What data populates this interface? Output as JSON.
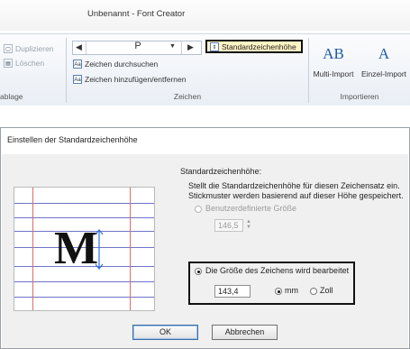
{
  "ribbon": {
    "window_title": "Unbenannt - Font Creator",
    "groups": {
      "clipboard_label": "ablage",
      "zeichen_label": "Zeichen",
      "importieren_label": "Importieren"
    },
    "clipboard": {
      "duplicate_label": "Duplizieren",
      "delete_label": "Löschen"
    },
    "nav": {
      "current_char": "P"
    },
    "zeichen": {
      "standard_height_label": "Standardzeichenhöhe",
      "search_label": "Zeichen durchsuchen",
      "add_remove_label": "Zeichen hinzufügen/entfernen"
    },
    "import": {
      "multi_glyph": "AB",
      "multi_label": "Multi-Import",
      "single_glyph": "A",
      "single_label": "Einzel-Import"
    }
  },
  "dialog": {
    "title": "Einstellen der Standardzeichenhöhe",
    "preview_letter": "M",
    "section_label": "Standardzeichenhöhe:",
    "description_line1": "Stellt die Standardzeichenhöhe für diesen Zeichensatz ein.",
    "description_line2": "Stickmuster werden basierend auf dieser Höhe gespeichert.",
    "option_custom_label": "Benutzerdefinierte Größe",
    "custom_value": "146,5",
    "option_current_label": "Die Größe des Zeichens wird bearbeitet",
    "current_value": "143,4",
    "unit_mm_label": "mm",
    "unit_inch_label": "Zoll",
    "selected_option": "current",
    "selected_unit": "mm",
    "ok_label": "OK",
    "cancel_label": "Abbrechen"
  },
  "colors": {
    "guide_horizontal": "#6f73c9",
    "guide_vertical": "#e06b6b",
    "height_arrow": "#2e6fe0",
    "highlight": "#fff3c4"
  }
}
